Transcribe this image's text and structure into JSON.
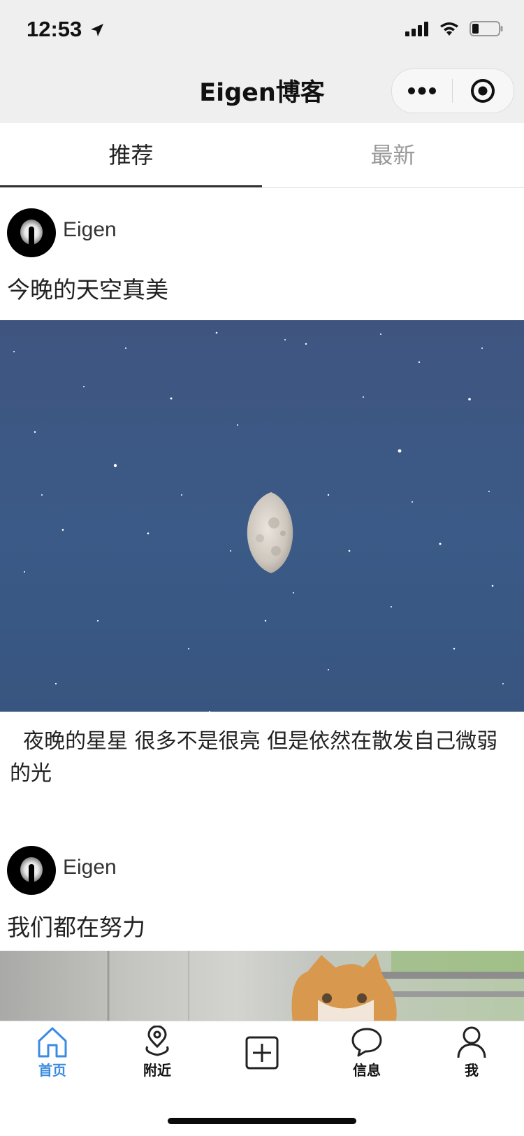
{
  "status_bar": {
    "time": "12:53",
    "icons": [
      "location-arrow-icon",
      "signal-icon",
      "wifi-icon",
      "battery-icon"
    ]
  },
  "nav": {
    "title": "Eigen博客",
    "capsule": [
      "more-icon",
      "close-target-icon"
    ]
  },
  "tabs": [
    {
      "label": "推荐",
      "active": true
    },
    {
      "label": "最新",
      "active": false
    }
  ],
  "posts": [
    {
      "author": "Eigen",
      "title": "今晚的天空真美",
      "body": "  夜晚的星星 很多不是很亮 但是依然在散发自己微弱的光"
    },
    {
      "author": "Eigen",
      "title": "我们都在努力",
      "body": ""
    }
  ],
  "bottom_tabs": [
    {
      "label": "首页",
      "icon": "home-icon",
      "active": true
    },
    {
      "label": "附近",
      "icon": "location-pin-icon",
      "active": false
    },
    {
      "label": "",
      "icon": "add-post-icon",
      "active": false
    },
    {
      "label": "信息",
      "icon": "message-bubble-icon",
      "active": false
    },
    {
      "label": "我",
      "icon": "person-icon",
      "active": false
    }
  ],
  "colors": {
    "accent": "#3b8be3",
    "nav_background": "#efefef",
    "tab_active": "#222222",
    "tab_inactive": "#9a9a9a"
  }
}
